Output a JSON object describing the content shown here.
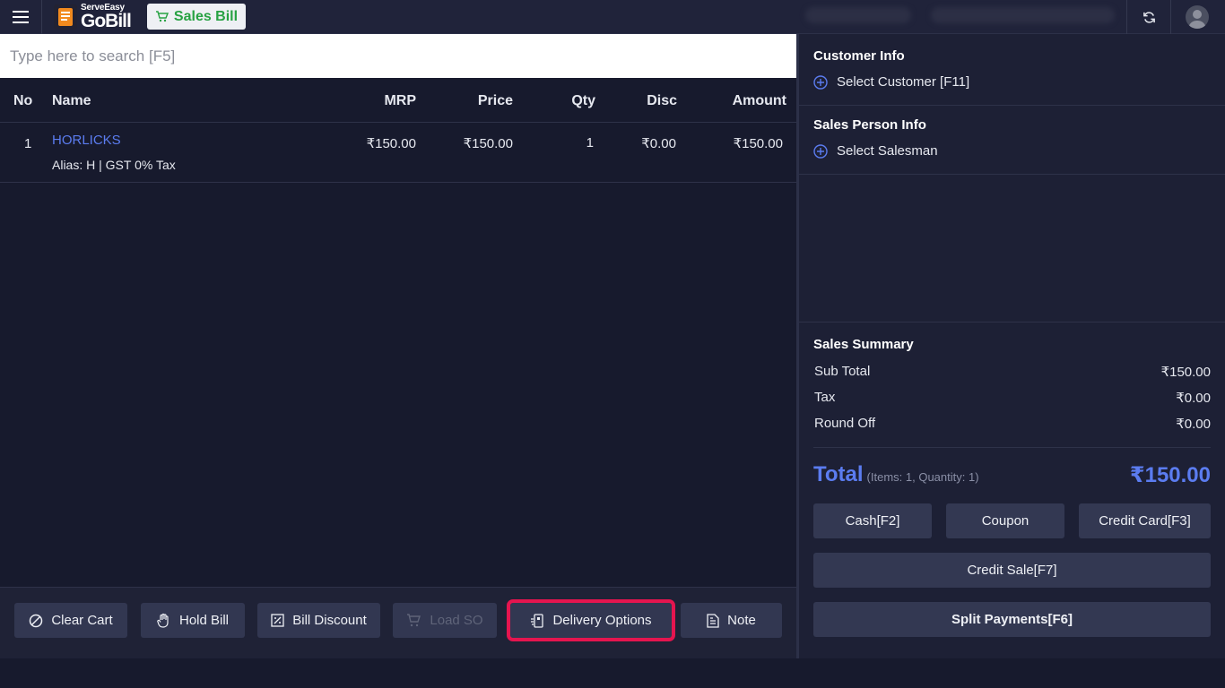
{
  "topbar": {
    "logo_small": "ServeEasy",
    "logo_big": "GoBill",
    "sales_tab": "Sales Bill"
  },
  "search": {
    "placeholder": "Type here to search [F5]"
  },
  "table": {
    "headers": {
      "no": "No",
      "name": "Name",
      "mrp": "MRP",
      "price": "Price",
      "qty": "Qty",
      "disc": "Disc",
      "amount": "Amount"
    },
    "rows": [
      {
        "no": "1",
        "name": "HORLICKS",
        "sub": "Alias: H | GST 0% Tax",
        "mrp": "₹150.00",
        "price": "₹150.00",
        "qty": "1",
        "disc": "₹0.00",
        "amount": "₹150.00"
      }
    ]
  },
  "toolbar": {
    "clear_cart": "Clear Cart",
    "hold_bill": "Hold Bill",
    "bill_discount": "Bill Discount",
    "load_so": "Load SO",
    "delivery_options": "Delivery Options",
    "note": "Note"
  },
  "customer": {
    "title": "Customer Info",
    "select": "Select Customer [F11]"
  },
  "salesperson": {
    "title": "Sales Person Info",
    "select": "Select Salesman"
  },
  "summary": {
    "title": "Sales Summary",
    "sub_total_label": "Sub Total",
    "sub_total": "₹150.00",
    "tax_label": "Tax",
    "tax": "₹0.00",
    "round_off_label": "Round Off",
    "round_off": "₹0.00",
    "total_label": "Total",
    "total_sub": "(Items: 1, Quantity: 1)",
    "total": "₹150.00"
  },
  "payments": {
    "cash": "Cash[F2]",
    "coupon": "Coupon",
    "credit_card": "Credit Card[F3]",
    "credit_sale": "Credit Sale[F7]",
    "split": "Split Payments[F6]"
  },
  "colors": {
    "accent": "#5b7cf0",
    "highlight": "#e5154f",
    "green": "#27a243"
  }
}
